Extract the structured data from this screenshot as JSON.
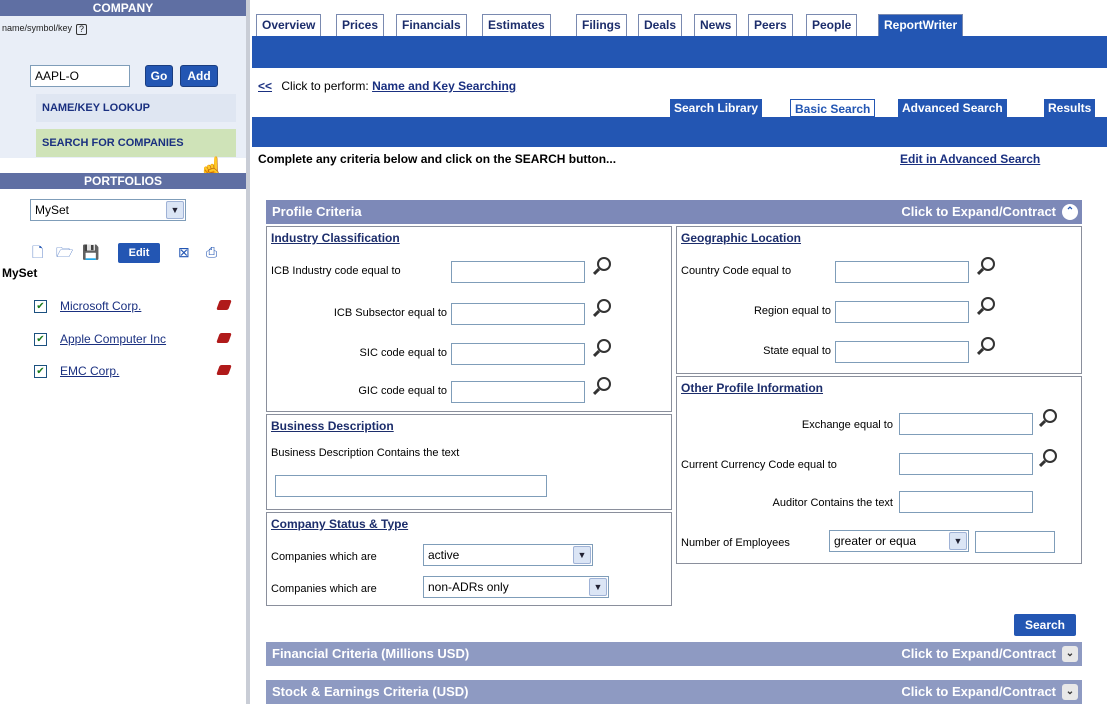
{
  "sidebar": {
    "company_title": "COMPANY",
    "name_symbol_label": "name/symbol/key",
    "help_glyph": "?",
    "ticker_value": "AAPL-O",
    "go_label": "Go",
    "add_label": "Add",
    "name_key_lookup": "NAME/KEY LOOKUP",
    "search_for_companies": "SEARCH FOR COMPANIES",
    "portfolios_title": "PORTFOLIOS",
    "portfolio_select": "MySet",
    "edit_label": "Edit",
    "myset_title": "MySet",
    "portfolio_items": [
      {
        "label": "Microsoft Corp."
      },
      {
        "label": "Apple Computer Inc"
      },
      {
        "label": "EMC Corp."
      }
    ]
  },
  "nav": {
    "tabs": [
      "Overview",
      "Prices",
      "Financials",
      "Estimates",
      "Filings",
      "Deals",
      "News",
      "Peers",
      "People",
      "ReportWriter"
    ]
  },
  "main": {
    "back_link": "<<",
    "click_perform": "Click to perform:",
    "name_key_searching": "Name and Key Searching",
    "subtabs": [
      "Search Library",
      "Basic Search",
      "Advanced Search",
      "Results"
    ],
    "intro": "Complete any criteria below and click on the SEARCH button...",
    "edit_advanced": "Edit in Advanced Search",
    "profile_criteria": "Profile Criteria",
    "expand_contract": "Click to Expand/Contract",
    "industry_title": "Industry Classification",
    "icb_industry": "ICB Industry code equal to",
    "icb_subsector": "ICB Subsector equal to",
    "sic_code": "SIC code equal to",
    "gic_code": "GIC code equal to",
    "business_title": "Business Description",
    "business_contains": "Business Description Contains the text",
    "status_title": "Company Status & Type",
    "companies_which_are": "Companies which are",
    "status_value_1": "active",
    "status_value_2": "non-ADRs only",
    "geo_title": "Geographic Location",
    "country_code": "Country Code equal to",
    "region": "Region equal to",
    "state": "State equal to",
    "other_title": "Other Profile Information",
    "exchange": "Exchange equal to",
    "currency": "Current Currency Code equal to",
    "auditor": "Auditor Contains the text",
    "employees": "Number of Employees",
    "employees_op": "greater or equa",
    "search_label": "Search",
    "financial_criteria": "Financial Criteria (Millions USD)",
    "stock_criteria": "Stock & Earnings Criteria (USD)"
  }
}
